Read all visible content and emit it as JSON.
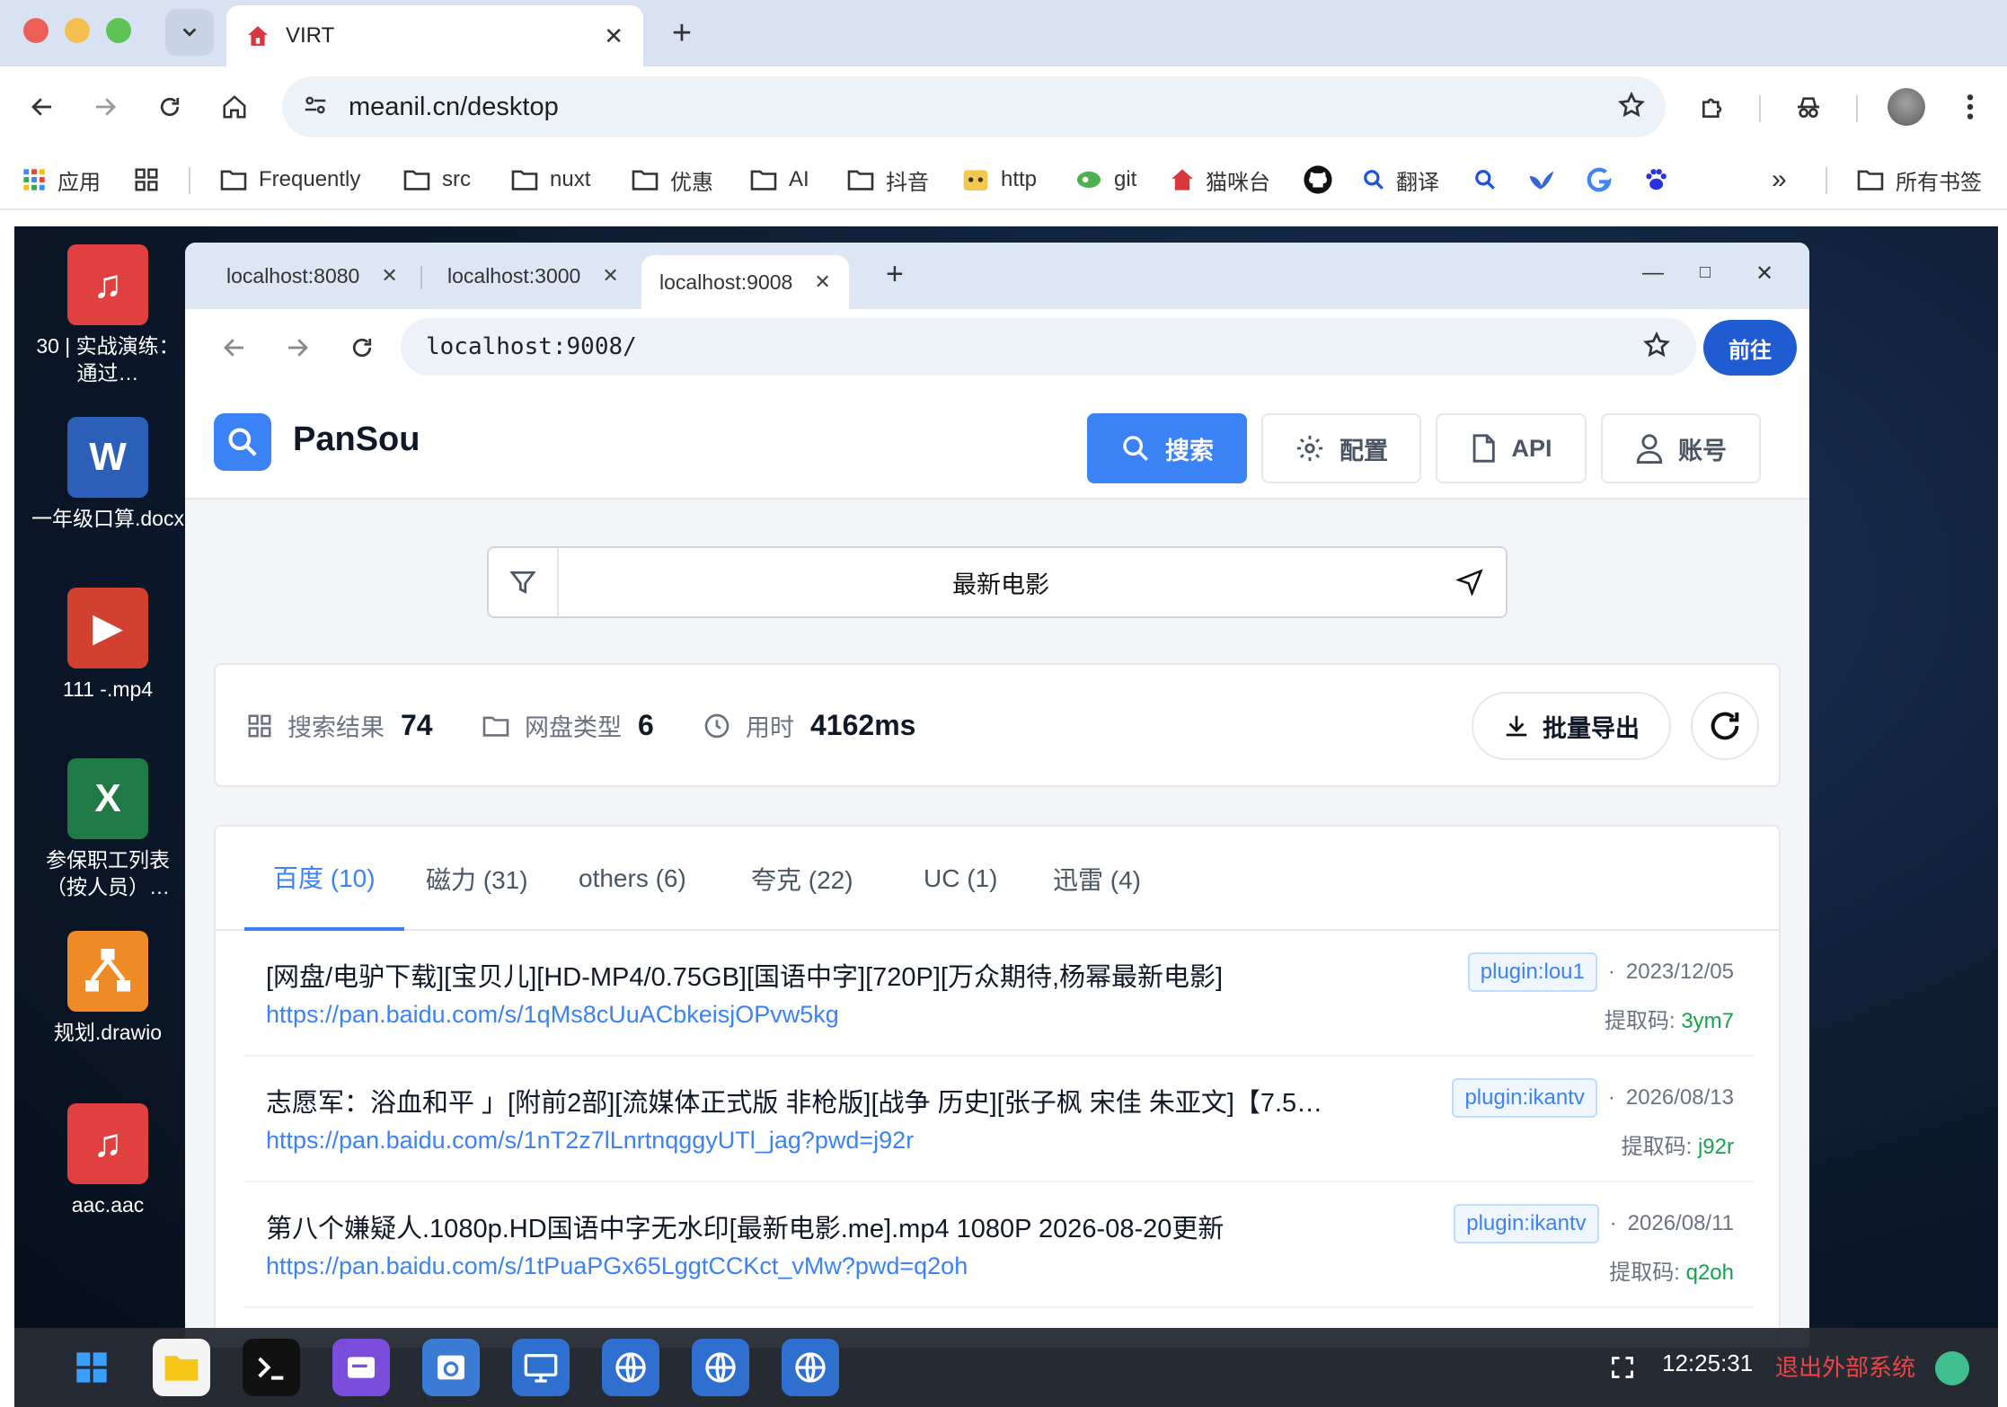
{
  "outer_browser": {
    "tab_title": "VIRT",
    "url": "meanil.cn/desktop",
    "bookmarks": [
      {
        "label": "应用",
        "icon": "apps-grid-icon"
      },
      {
        "label": "",
        "icon": "tab-groups-icon"
      },
      {
        "label": "Frequently",
        "icon": "folder-icon"
      },
      {
        "label": "src",
        "icon": "folder-icon"
      },
      {
        "label": "nuxt",
        "icon": "folder-icon"
      },
      {
        "label": "优惠",
        "icon": "folder-icon"
      },
      {
        "label": "AI",
        "icon": "folder-icon"
      },
      {
        "label": "抖音",
        "icon": "folder-icon"
      },
      {
        "label": "http",
        "icon": "cat-icon"
      },
      {
        "label": "git",
        "icon": "git-icon"
      },
      {
        "label": "猫咪台",
        "icon": "house-icon"
      },
      {
        "label": "",
        "icon": "github-icon"
      },
      {
        "label": "翻译",
        "icon": "search-icon"
      },
      {
        "label": "",
        "icon": "search-icon"
      },
      {
        "label": "",
        "icon": "bird-icon"
      },
      {
        "label": "",
        "icon": "google-icon"
      },
      {
        "label": "",
        "icon": "paw-icon"
      }
    ],
    "bookmarks_more": "»",
    "all_bookmarks": "所有书签"
  },
  "desktop_icons": [
    {
      "label": "30 | 实战演练：通过…",
      "icon": "music-file-icon",
      "color": "#e0403f"
    },
    {
      "label": "一年级口算.docx",
      "icon": "word-file-icon",
      "color": "#2b5fb8"
    },
    {
      "label": "111 -.mp4",
      "icon": "video-file-icon",
      "color": "#d2412f"
    },
    {
      "label": "参保职工列表（按人员）…",
      "icon": "excel-file-icon",
      "color": "#1f7a45"
    },
    {
      "label": "规划.drawio",
      "icon": "drawio-file-icon",
      "color": "#f08a24"
    },
    {
      "label": "aac.aac",
      "icon": "music-file-icon",
      "color": "#e0403f"
    }
  ],
  "inner_browser": {
    "tabs": [
      {
        "label": "localhost:8080"
      },
      {
        "label": "localhost:3000"
      },
      {
        "label": "localhost:9008"
      }
    ],
    "url": "localhost:9008/",
    "go_label": "前往"
  },
  "app": {
    "brand": "PanSou",
    "nav": {
      "search": "搜索",
      "config": "配置",
      "api": "API",
      "account": "账号"
    },
    "search_query": "最新电影",
    "stats": {
      "results_label": "搜索结果",
      "results_value": "74",
      "types_label": "网盘类型",
      "types_value": "6",
      "time_label": "用时",
      "time_value": "4162ms"
    },
    "export_label": "批量导出",
    "tabs": [
      {
        "label": "百度 (10)"
      },
      {
        "label": "磁力 (31)"
      },
      {
        "label": "others (6)"
      },
      {
        "label": "夸克 (22)"
      },
      {
        "label": "UC (1)"
      },
      {
        "label": "迅雷 (4)"
      }
    ],
    "code_label": "提取码:",
    "results": [
      {
        "title": "[网盘/电驴下载][宝贝儿][HD-MP4/0.75GB][国语中字][720P][万众期待,杨幂最新电影]",
        "link": "https://pan.baidu.com/s/1qMs8cUuACbkeisjOPvw5kg",
        "plugin": "plugin:lou1",
        "date": "2023/12/05",
        "code": "3ym7"
      },
      {
        "title": "志愿军：浴血和平 」[附前2部][流媒体正式版 非枪版][战争 历史][张子枫 宋佳 朱亚文]【7.5…",
        "link": "https://pan.baidu.com/s/1nT2z7lLnrtnqggyUTl_jag?pwd=j92r",
        "plugin": "plugin:ikantv",
        "date": "2026/08/13",
        "code": "j92r"
      },
      {
        "title": "第八个嫌疑人.1080p.HD国语中字无水印[最新电影.me].mp4 1080P 2026-08-20更新",
        "link": "https://pan.baidu.com/s/1tPuaPGx65LggtCCKct_vMw?pwd=q2oh",
        "plugin": "plugin:ikantv",
        "date": "2026/08/11",
        "code": "q2oh"
      }
    ]
  },
  "taskbar": {
    "clock": "12:25:31",
    "exit_label": "退出外部系统"
  },
  "colors": {
    "accent": "#3b82f6",
    "go_button": "#1f5bd1",
    "code_green": "#16a34a",
    "exit_red": "#ef4444"
  }
}
